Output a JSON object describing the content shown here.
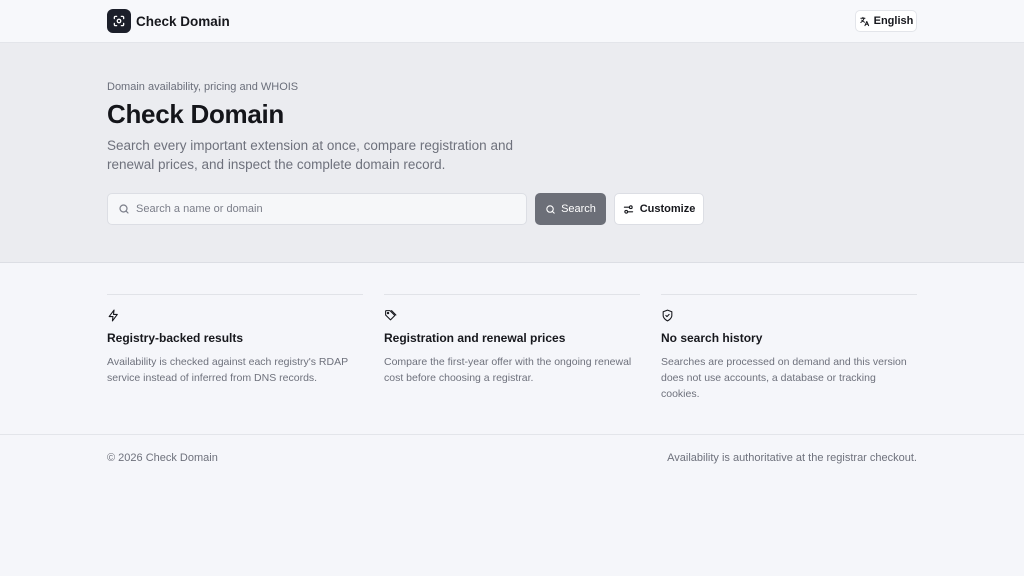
{
  "header": {
    "brand_name": "Check Domain",
    "brand_icon": "scan-icon",
    "language_label": "English",
    "language_icon": "translate-icon"
  },
  "hero": {
    "eyebrow": "Domain availability, pricing and WHOIS",
    "title": "Check Domain",
    "subtitle": "Search every important extension at once, compare registration and renewal prices, and inspect the complete domain record.",
    "search": {
      "placeholder": "Search a name or domain",
      "value": ""
    },
    "search_button_label": "Search",
    "customize_button_label": "Customize"
  },
  "features": [
    {
      "icon": "zap-icon",
      "title": "Registry-backed results",
      "description": "Availability is checked against each registry's RDAP service instead of inferred from DNS records."
    },
    {
      "icon": "tags-icon",
      "title": "Registration and renewal prices",
      "description": "Compare the first-year offer with the ongoing renewal cost before choosing a registrar."
    },
    {
      "icon": "shield-check-icon",
      "title": "No search history",
      "description": "Searches are processed on demand and this version does not use accounts, a database or tracking cookies."
    }
  ],
  "footer": {
    "copyright": "© 2026 Check Domain",
    "note": "Availability is authoritative at the registrar checkout."
  },
  "colors": {
    "page_bg": "#f5f6fa",
    "hero_bg": "#ebecf0",
    "brand_dark": "#1c1f2a",
    "search_button_bg": "#6c6f78",
    "muted_text": "#6e717c"
  }
}
